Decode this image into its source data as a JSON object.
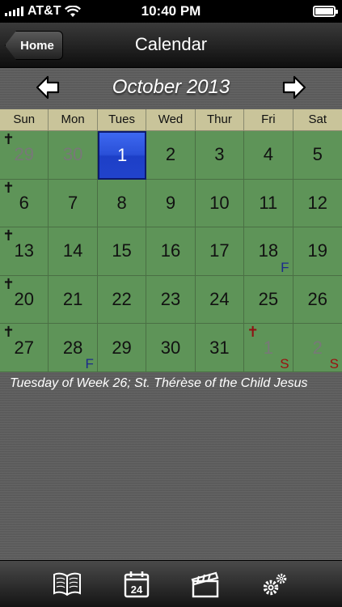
{
  "status": {
    "carrier": "AT&T",
    "time": "10:40 PM"
  },
  "nav": {
    "back_label": "Home",
    "title": "Calendar"
  },
  "calendar": {
    "month": "October 2013",
    "weekdays": [
      "Sun",
      "Mon",
      "Tues",
      "Wed",
      "Thur",
      "Fri",
      "Sat"
    ],
    "days": [
      {
        "num": "29",
        "other": true,
        "cross": "black"
      },
      {
        "num": "30",
        "other": true
      },
      {
        "num": "1",
        "selected": true
      },
      {
        "num": "2"
      },
      {
        "num": "3"
      },
      {
        "num": "4"
      },
      {
        "num": "5"
      },
      {
        "num": "6",
        "cross": "black"
      },
      {
        "num": "7"
      },
      {
        "num": "8"
      },
      {
        "num": "9"
      },
      {
        "num": "10"
      },
      {
        "num": "11"
      },
      {
        "num": "12"
      },
      {
        "num": "13",
        "cross": "black"
      },
      {
        "num": "14"
      },
      {
        "num": "15"
      },
      {
        "num": "16"
      },
      {
        "num": "17"
      },
      {
        "num": "18",
        "badge": "F"
      },
      {
        "num": "19"
      },
      {
        "num": "20",
        "cross": "black"
      },
      {
        "num": "21"
      },
      {
        "num": "22"
      },
      {
        "num": "23"
      },
      {
        "num": "24"
      },
      {
        "num": "25"
      },
      {
        "num": "26"
      },
      {
        "num": "27",
        "cross": "black"
      },
      {
        "num": "28",
        "badge": "F"
      },
      {
        "num": "29"
      },
      {
        "num": "30"
      },
      {
        "num": "31"
      },
      {
        "num": "1",
        "other": true,
        "cross": "red",
        "badge": "S"
      },
      {
        "num": "2",
        "other": true,
        "badge": "S"
      }
    ]
  },
  "description": "Tuesday of Week 26; St. Thérèse of the Child Jesus",
  "tabs": [
    {
      "icon": "book-icon",
      "name": "tab-readings"
    },
    {
      "icon": "calendar-24-icon",
      "name": "tab-calendar",
      "number": "24"
    },
    {
      "icon": "clapperboard-icon",
      "name": "tab-media"
    },
    {
      "icon": "gears-icon",
      "name": "tab-settings"
    }
  ]
}
